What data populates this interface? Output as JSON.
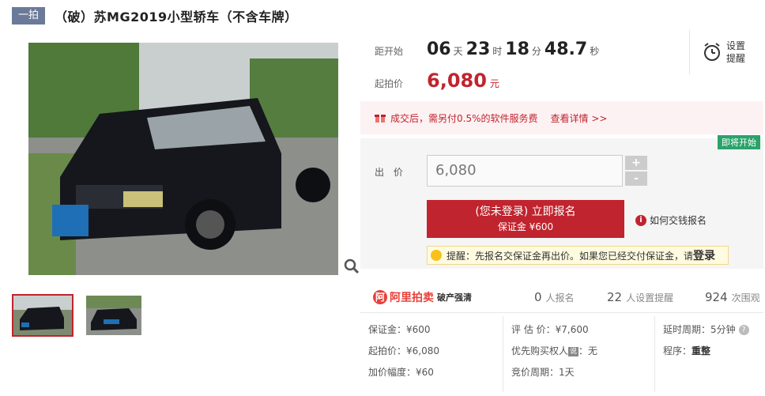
{
  "header": {
    "badge": "一拍",
    "title": "（破）苏MG2019小型轿车（不含车牌）"
  },
  "images": {
    "main_alt": "black sedan car photo",
    "thumbs": [
      "thumbnail front view",
      "thumbnail rear view"
    ]
  },
  "countdown": {
    "label": "距开始",
    "days": "06",
    "days_unit": "天",
    "hours": "23",
    "hours_unit": "时",
    "minutes": "18",
    "minutes_unit": "分",
    "seconds": "48.7",
    "seconds_unit": "秒"
  },
  "start_price": {
    "label": "起拍价",
    "value": "6,080",
    "unit": "元"
  },
  "reminder": {
    "label": "设置提醒",
    "icon": "alarm-clock-icon"
  },
  "fee_notice": {
    "text": "成交后，需另付0.5%的软件服务费",
    "detail_link": "查看详情 >>"
  },
  "bid": {
    "status_tag": "即将开始",
    "label": "出 价",
    "input_value": "6,080",
    "plus": "+",
    "minus": "-",
    "button_main": "(您未登录) 立即报名",
    "button_sub": "保证金 ¥600",
    "howpay": "如何交钱报名",
    "tip_text": "提醒：先报名交保证金再出价。如果您已经交付保证金，请",
    "tip_login": "登录"
  },
  "stats": {
    "brand": "阿里拍卖",
    "brand_sub": "破产强清",
    "signups_n": "0",
    "signups_label": "人报名",
    "reminders_n": "22",
    "reminders_label": "人设置提醒",
    "views_n": "924",
    "views_label": "次围观"
  },
  "details": {
    "deposit": "保证金：¥600",
    "start_price": "起拍价：¥6,080",
    "increment": "加价幅度：¥60",
    "appraisal": "评 估 价：¥7,600",
    "priority_label": "优先购买权人",
    "priority_badge": "说",
    "priority_value": "：无",
    "bid_cycle": "竞价周期：1天",
    "delay": "延时周期：5分钟",
    "procedure_label": "程序：",
    "procedure_value": "重整"
  },
  "colors": {
    "accent": "#c0242e",
    "badge": "#6b7a99",
    "soon_tag": "#2aa36a",
    "brand": "#e8403a"
  }
}
